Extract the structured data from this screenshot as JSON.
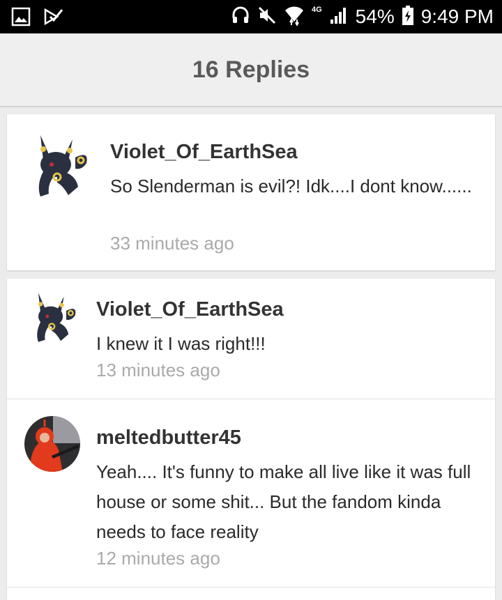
{
  "status_bar": {
    "network_label": "4G",
    "battery": "54%",
    "time": "9:49 PM"
  },
  "header": {
    "title": "16 Replies"
  },
  "comments": [
    {
      "author": "Violet_Of_EarthSea",
      "text": "So Slenderman is evil?! Idk....I dont know......",
      "time": "33 minutes ago",
      "avatar": "umbreon-avatar"
    },
    {
      "author": "Violet_Of_EarthSea",
      "text": "I knew it I was right!!!",
      "time": "13 minutes ago",
      "avatar": "umbreon-avatar"
    },
    {
      "author": "meltedbutter45",
      "text": "Yeah.... It's funny to make all live like it was full house or some shit... But the fandom kinda needs to face reality",
      "time": "12 minutes ago",
      "avatar": "red-costume-avatar"
    }
  ]
}
